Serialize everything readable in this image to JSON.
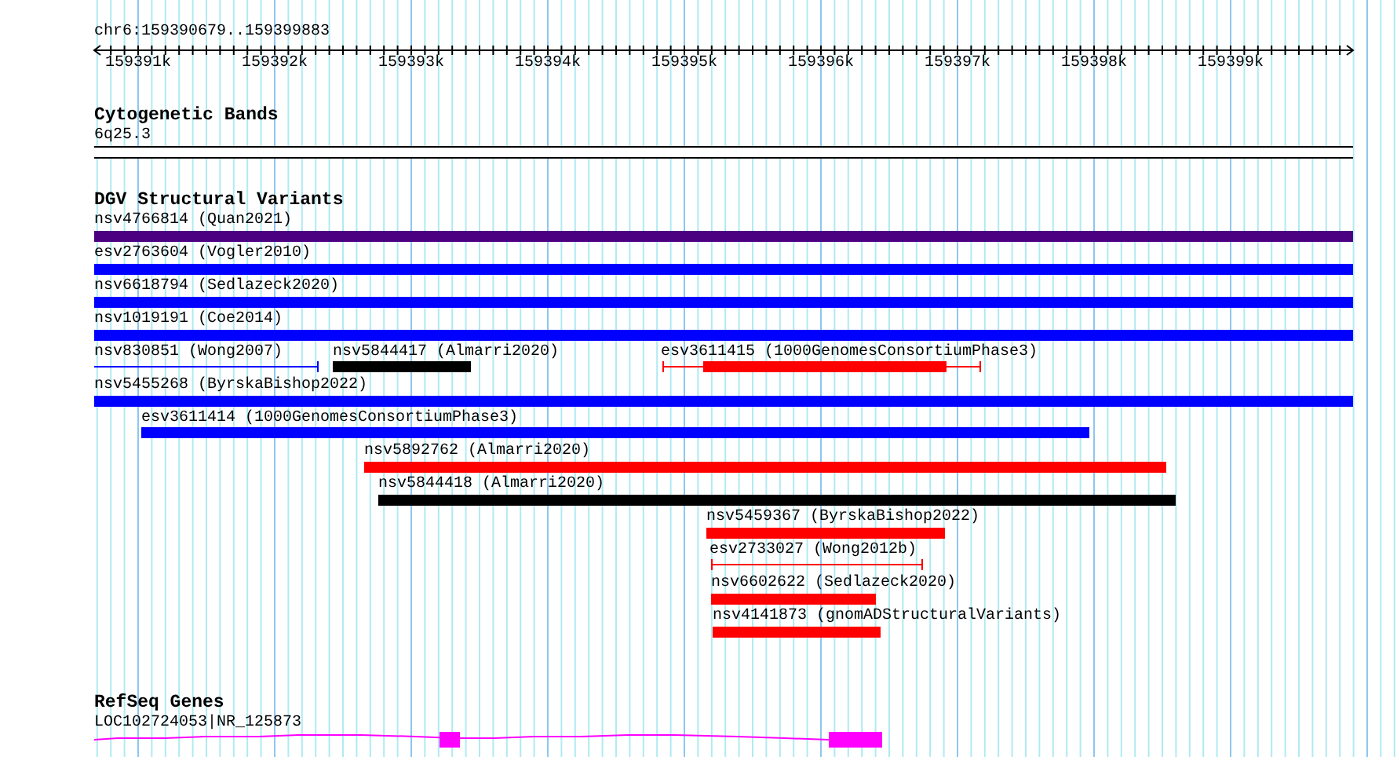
{
  "position": "chr6:159390679..159399883",
  "ruler": {
    "ticks": [
      "159391k",
      "159392k",
      "159393k",
      "159394k",
      "159395k",
      "159396k",
      "159397k",
      "159398k",
      "159399k"
    ]
  },
  "cytogenetic_bands": {
    "title": "Cytogenetic Bands",
    "band": "6q25.3"
  },
  "dgv_variants": {
    "title": "DGV Structural Variants",
    "items": [
      {
        "label": "nsv4766814 (Quan2021)",
        "kind": "bar",
        "color": "#4b0082"
      },
      {
        "label": "esv2763604 (Vogler2010)",
        "kind": "bar",
        "color": "#0000ff"
      },
      {
        "label": "nsv6618794 (Sedlazeck2020)",
        "kind": "bar",
        "color": "#0000ff"
      },
      {
        "label": "nsv1019191 (Coe2014)",
        "kind": "bar",
        "color": "#0000ff"
      },
      {
        "label": "nsv830851 (Wong2007)",
        "kind": "line",
        "color": "#0000ff"
      },
      {
        "label": "nsv5844417 (Almarri2020)",
        "kind": "bar",
        "color": "#000000"
      },
      {
        "label": "esv3611415 (1000GenomesConsortiumPhase3)",
        "kind": "whisker",
        "color": "#ff0000"
      },
      {
        "label": "nsv5455268 (ByrskaBishop2022)",
        "kind": "bar",
        "color": "#0000ff"
      },
      {
        "label": "esv3611414 (1000GenomesConsortiumPhase3)",
        "kind": "bar",
        "color": "#0000ff"
      },
      {
        "label": "nsv5892762 (Almarri2020)",
        "kind": "bar",
        "color": "#ff0000"
      },
      {
        "label": "nsv5844418 (Almarri2020)",
        "kind": "bar",
        "color": "#000000"
      },
      {
        "label": "nsv5459367 (ByrskaBishop2022)",
        "kind": "bar",
        "color": "#ff0000"
      },
      {
        "label": "esv2733027 (Wong2012b)",
        "kind": "line",
        "color": "#ff0000"
      },
      {
        "label": "nsv6602622 (Sedlazeck2020)",
        "kind": "bar",
        "color": "#ff0000"
      },
      {
        "label": "nsv4141873 (gnomADStructuralVariants)",
        "kind": "bar",
        "color": "#ff0000"
      }
    ]
  },
  "refseq_genes": {
    "title": "RefSeq Genes",
    "genes": [
      {
        "label": "LOC102724053|NR_125873"
      }
    ]
  }
}
